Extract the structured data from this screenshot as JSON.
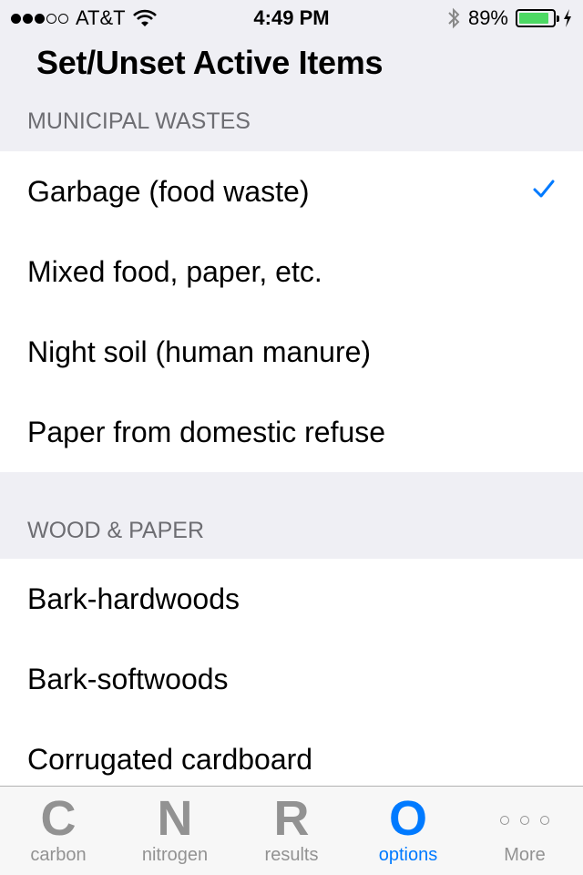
{
  "status_bar": {
    "signal_bars_filled": 3,
    "signal_bars_total": 5,
    "carrier": "AT&T",
    "time": "4:49 PM",
    "battery_percent_text": "89%",
    "battery_level": 0.89,
    "battery_color": "#4cd964",
    "charging": true
  },
  "nav": {
    "title": "Set/Unset Active Items"
  },
  "sections": [
    {
      "header": "MUNICIPAL WASTES",
      "items": [
        {
          "label": "Garbage (food waste)",
          "checked": true
        },
        {
          "label": "Mixed food, paper, etc.",
          "checked": false
        },
        {
          "label": "Night soil (human manure)",
          "checked": false
        },
        {
          "label": "Paper from domestic refuse",
          "checked": false
        }
      ]
    },
    {
      "header": "WOOD & PAPER",
      "items": [
        {
          "label": "Bark-hardwoods",
          "checked": false
        },
        {
          "label": "Bark-softwoods",
          "checked": false
        },
        {
          "label": "Corrugated cardboard",
          "checked": false
        }
      ]
    }
  ],
  "tab_bar": {
    "accent_color": "#007aff",
    "tabs": [
      {
        "glyph": "C",
        "label": "carbon",
        "active": false
      },
      {
        "glyph": "N",
        "label": "nitrogen",
        "active": false
      },
      {
        "glyph": "R",
        "label": "results",
        "active": false
      },
      {
        "glyph": "O",
        "label": "options",
        "active": true
      },
      {
        "glyph": "more-icon",
        "label": "More",
        "active": false
      }
    ]
  }
}
